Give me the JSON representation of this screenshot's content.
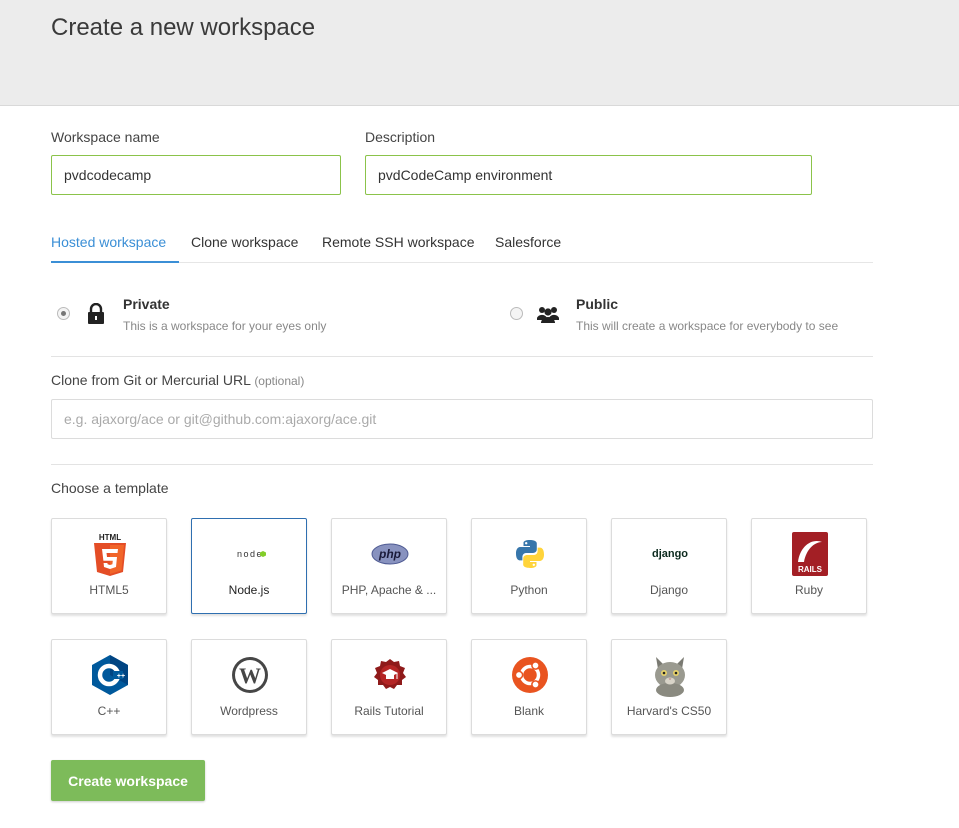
{
  "header": {
    "title": "Create a new workspace"
  },
  "form": {
    "workspace_name": {
      "label": "Workspace name",
      "value": "pvdcodecamp"
    },
    "description": {
      "label": "Description",
      "value": "pvdCodeCamp environment"
    }
  },
  "tabs": [
    {
      "label": "Hosted workspace",
      "active": true
    },
    {
      "label": "Clone workspace",
      "active": false
    },
    {
      "label": "Remote SSH workspace",
      "active": false
    },
    {
      "label": "Salesforce",
      "active": false
    }
  ],
  "visibility": {
    "private": {
      "title": "Private",
      "desc": "This is a workspace for your eyes only",
      "icon": "lock-icon",
      "selected": true
    },
    "public": {
      "title": "Public",
      "desc": "This will create a workspace for everybody to see",
      "icon": "users-icon",
      "selected": false
    }
  },
  "clone": {
    "label": "Clone from Git or Mercurial URL",
    "optional": "(optional)",
    "placeholder": "e.g. ajaxorg/ace or git@github.com:ajaxorg/ace.git",
    "value": ""
  },
  "templates": {
    "label": "Choose a template",
    "items": [
      {
        "label": "HTML5",
        "icon": "html5-icon",
        "logo_text": "HTML",
        "selected": false
      },
      {
        "label": "Node.js",
        "icon": "nodejs-icon",
        "logo_text": "node",
        "selected": true
      },
      {
        "label": "PHP, Apache & ...",
        "icon": "php-icon",
        "logo_text": "php",
        "selected": false
      },
      {
        "label": "Python",
        "icon": "python-icon",
        "selected": false
      },
      {
        "label": "Django",
        "icon": "django-icon",
        "logo_text": "django",
        "selected": false
      },
      {
        "label": "Ruby",
        "icon": "rails-icon",
        "logo_text": "RAILS",
        "selected": false
      },
      {
        "label": "C++",
        "icon": "cpp-icon",
        "selected": false
      },
      {
        "label": "Wordpress",
        "icon": "wordpress-icon",
        "logo_text": "W",
        "selected": false
      },
      {
        "label": "Rails Tutorial",
        "icon": "rails-tutorial-icon",
        "selected": false
      },
      {
        "label": "Blank",
        "icon": "ubuntu-icon",
        "selected": false
      },
      {
        "label": "Harvard's CS50",
        "icon": "cat-icon",
        "selected": false
      }
    ]
  },
  "actions": {
    "create_label": "Create workspace"
  },
  "colors": {
    "accent": "#3b8fd6",
    "input_border": "#8bc34a",
    "button": "#7dbb5a"
  }
}
